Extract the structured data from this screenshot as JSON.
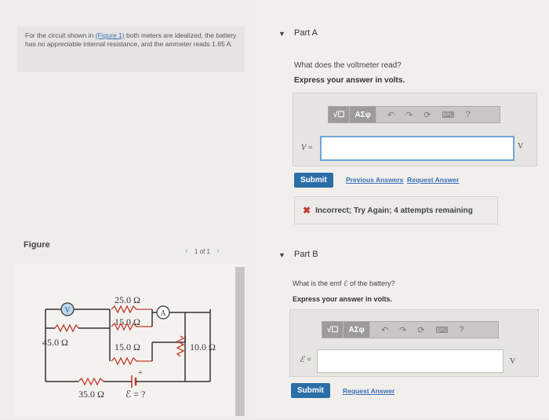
{
  "problem": {
    "text_before": "For the circuit shown in ",
    "figure_link": "(Figure 1)",
    "text_after": " both meters are idealized, the battery has no appreciable internal resistance, and the ammeter reads 1.65 A."
  },
  "figure": {
    "label": "Figure",
    "pager": "1 of 1",
    "circuit": {
      "voltmeter": "V",
      "ammeter": "A",
      "r1": "25.0 Ω",
      "r2": "15.0 Ω",
      "r3": "45.0 Ω",
      "r4": "15.0 Ω",
      "r5": "10.0 Ω",
      "r6": "35.0 Ω",
      "emf": "ℰ = ?",
      "plus": "+"
    }
  },
  "partA": {
    "title": "Part A",
    "question": "What does the voltmeter read?",
    "instruction": "Express your answer in volts.",
    "toolbar": {
      "templates": "√☐",
      "greek": "ΑΣφ",
      "help": "?"
    },
    "var_label": "V =",
    "input_value": "",
    "unit": "V",
    "submit": "Submit",
    "previous": "Previous Answers",
    "request": "Request Answer",
    "feedback": "Incorrect; Try Again; 4 attempts remaining"
  },
  "partB": {
    "title": "Part B",
    "question": "What is the emf ℰ of the battery?",
    "instruction": "Express your answer in volts.",
    "toolbar": {
      "templates": "√☐",
      "greek": "ΑΣφ",
      "help": "?"
    },
    "var_label": "ℰ =",
    "input_value": "",
    "unit": "V",
    "submit": "Submit",
    "request": "Request Answer"
  }
}
